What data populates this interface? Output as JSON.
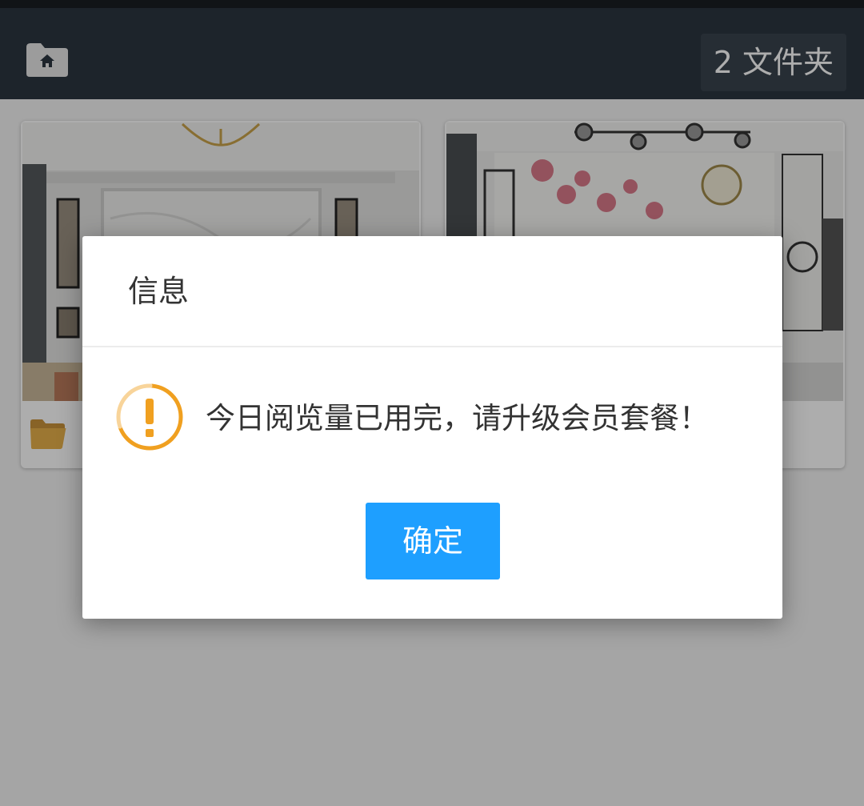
{
  "header": {
    "home_icon": "home-folder-icon",
    "folder_count_label": "2 文件夹"
  },
  "folders": [
    {
      "thumbnail": "living-room-marble-wall",
      "icon": "folder-icon"
    },
    {
      "thumbnail": "living-room-magnolia-mural",
      "icon": "folder-icon"
    }
  ],
  "dialog": {
    "title": "信息",
    "icon": "warning-icon",
    "message": "今日阅览量已用完，请升级会员套餐！",
    "confirm_label": "确定"
  },
  "colors": {
    "header_bg": "#2c3640",
    "accent_button": "#1e9fff",
    "warning": "#f0a020",
    "folder": "#e0a83a"
  }
}
